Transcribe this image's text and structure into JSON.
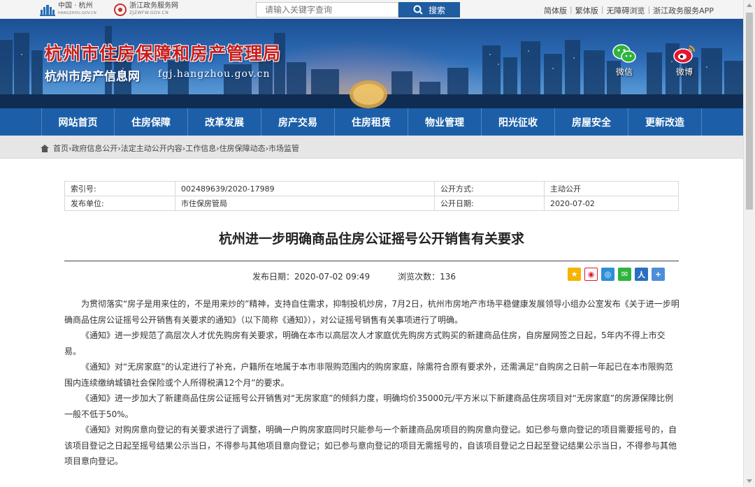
{
  "topbar": {
    "logo1_text": "中国 · 杭州",
    "logo1_sub": "HANGZHOU.GOV.CN",
    "logo2_text": "浙江政务服务网",
    "logo2_sub": "ZJZWFW.GOV.CN",
    "search_placeholder": "请输入关键字查询",
    "search_label": "搜索",
    "links": [
      "简体版",
      "繁体版",
      "无障碍浏览",
      "浙江政务服务APP"
    ]
  },
  "banner": {
    "title": "杭州市住房保障和房产管理局",
    "subtitle": "杭州市房产信息网",
    "domain": "fgj.hangzhou.gov.cn",
    "wechat_label": "微信",
    "weibo_label": "微博"
  },
  "nav": {
    "items": [
      "网站首页",
      "住房保障",
      "改革发展",
      "房产交易",
      "住房租赁",
      "物业管理",
      "阳光征收",
      "房屋安全",
      "更新改造"
    ]
  },
  "breadcrumb": {
    "path": "首页›政府信息公开›法定主动公开内容›工作信息›住房保障动态›市场监管"
  },
  "meta": {
    "index_label": "索引号:",
    "index_value": "002489639/2020-17989",
    "disclosure_label": "公开方式:",
    "disclosure_value": "主动公开",
    "publisher_label": "发布单位:",
    "publisher_value": "市住保房管局",
    "date_label": "公开日期:",
    "date_value": "2020-07-02"
  },
  "article": {
    "title": "杭州进一步明确商品住房公证摇号公开销售有关要求",
    "publish_time": "发布日期：2020-07-02 09:49",
    "views": "浏览次数：136",
    "paragraphs": [
      "为贯彻落实“房子是用来住的，不是用来炒的”精神，支持自住需求，抑制投机炒房，7月2日，杭州市房地产市场平稳健康发展领导小组办公室发布《关于进一步明确商品住房公证摇号公开销售有关要求的通知》（以下简称《通知》），对公证摇号销售有关事项进行了明确。",
      "《通知》进一步规范了高层次人才优先购房有关要求，明确在本市以高层次人才家庭优先购房方式购买的新建商品住房，自房屋网签之日起，5年内不得上市交易。",
      "《通知》对“无房家庭”的认定进行了补充，户籍所在地属于本市非限购范围内的购房家庭，除需符合原有要求外，还需满足“自购房之日前一年起已在本市限购范围内连续缴纳城镇社会保险或个人所得税满12个月”的要求。",
      "《通知》进一步加大了新建商品住房公证摇号公开销售对“无房家庭”的倾斜力度，明确均价35000元/平方米以下新建商品住房项目对“无房家庭”的房源保障比例一般不低于50%。",
      "《通知》对购房意向登记的有关要求进行了调整，明确一户购房家庭同时只能参与一个新建商品房项目的购房意向登记。如已参与意向登记的项目需要摇号的，自该项目登记之日起至摇号结果公示当日，不得参与其他项目意向登记；如已参与意向登记的项目无需摇号的，自该项目登记之日起至登记结果公示当日，不得参与其他项目意向登记。"
    ]
  },
  "share_icons": [
    "qzone-icon",
    "weibo-share-icon",
    "tencent-weibo-icon",
    "wechat-share-icon",
    "renren-icon",
    "more-share-icon"
  ]
}
